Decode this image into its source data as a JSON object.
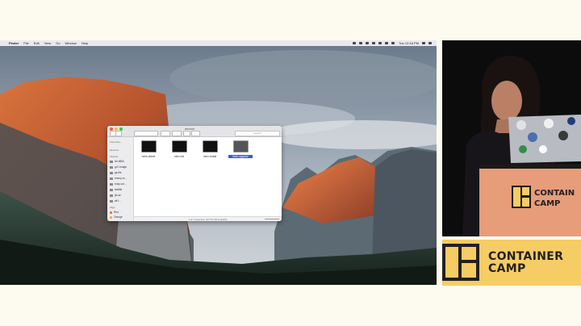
{
  "menubar": {
    "apple": "",
    "app": "Finder",
    "menus": [
      "File",
      "Edit",
      "View",
      "Go",
      "Window",
      "Help"
    ],
    "clock": "Tue 12:18 PM"
  },
  "finder": {
    "title": "demos",
    "search_placeholder": "Search",
    "sidebar": {
      "favorites_heading": "Favorites",
      "devices_heading": "Devices",
      "shared_heading": "Shared",
      "items": [
        "Air MBA",
        "go?-image",
        "gk-file",
        "emmy-m...",
        "busy-col...",
        "testfile",
        "jet-se",
        "all-f..."
      ],
      "tags_heading": "Tags",
      "tags": [
        "Red",
        "Orange"
      ]
    },
    "files": [
      {
        "name": "hetm-delete"
      },
      {
        "name": "heim-init"
      },
      {
        "name": "heim-install"
      },
      {
        "name": "helm-upgrade"
      }
    ],
    "status": "1 of 4 selected, 107.55 GB available"
  },
  "logo": {
    "line1": "CONTAINER",
    "line2": "CAMP",
    "banner_line1": "CONTAIN",
    "banner_line2": "CAMP",
    "brand_color": "#f6cc64"
  },
  "colors": {
    "tag_red": "#f45952",
    "tag_orange": "#f5a623",
    "selection": "#2a63d6"
  }
}
